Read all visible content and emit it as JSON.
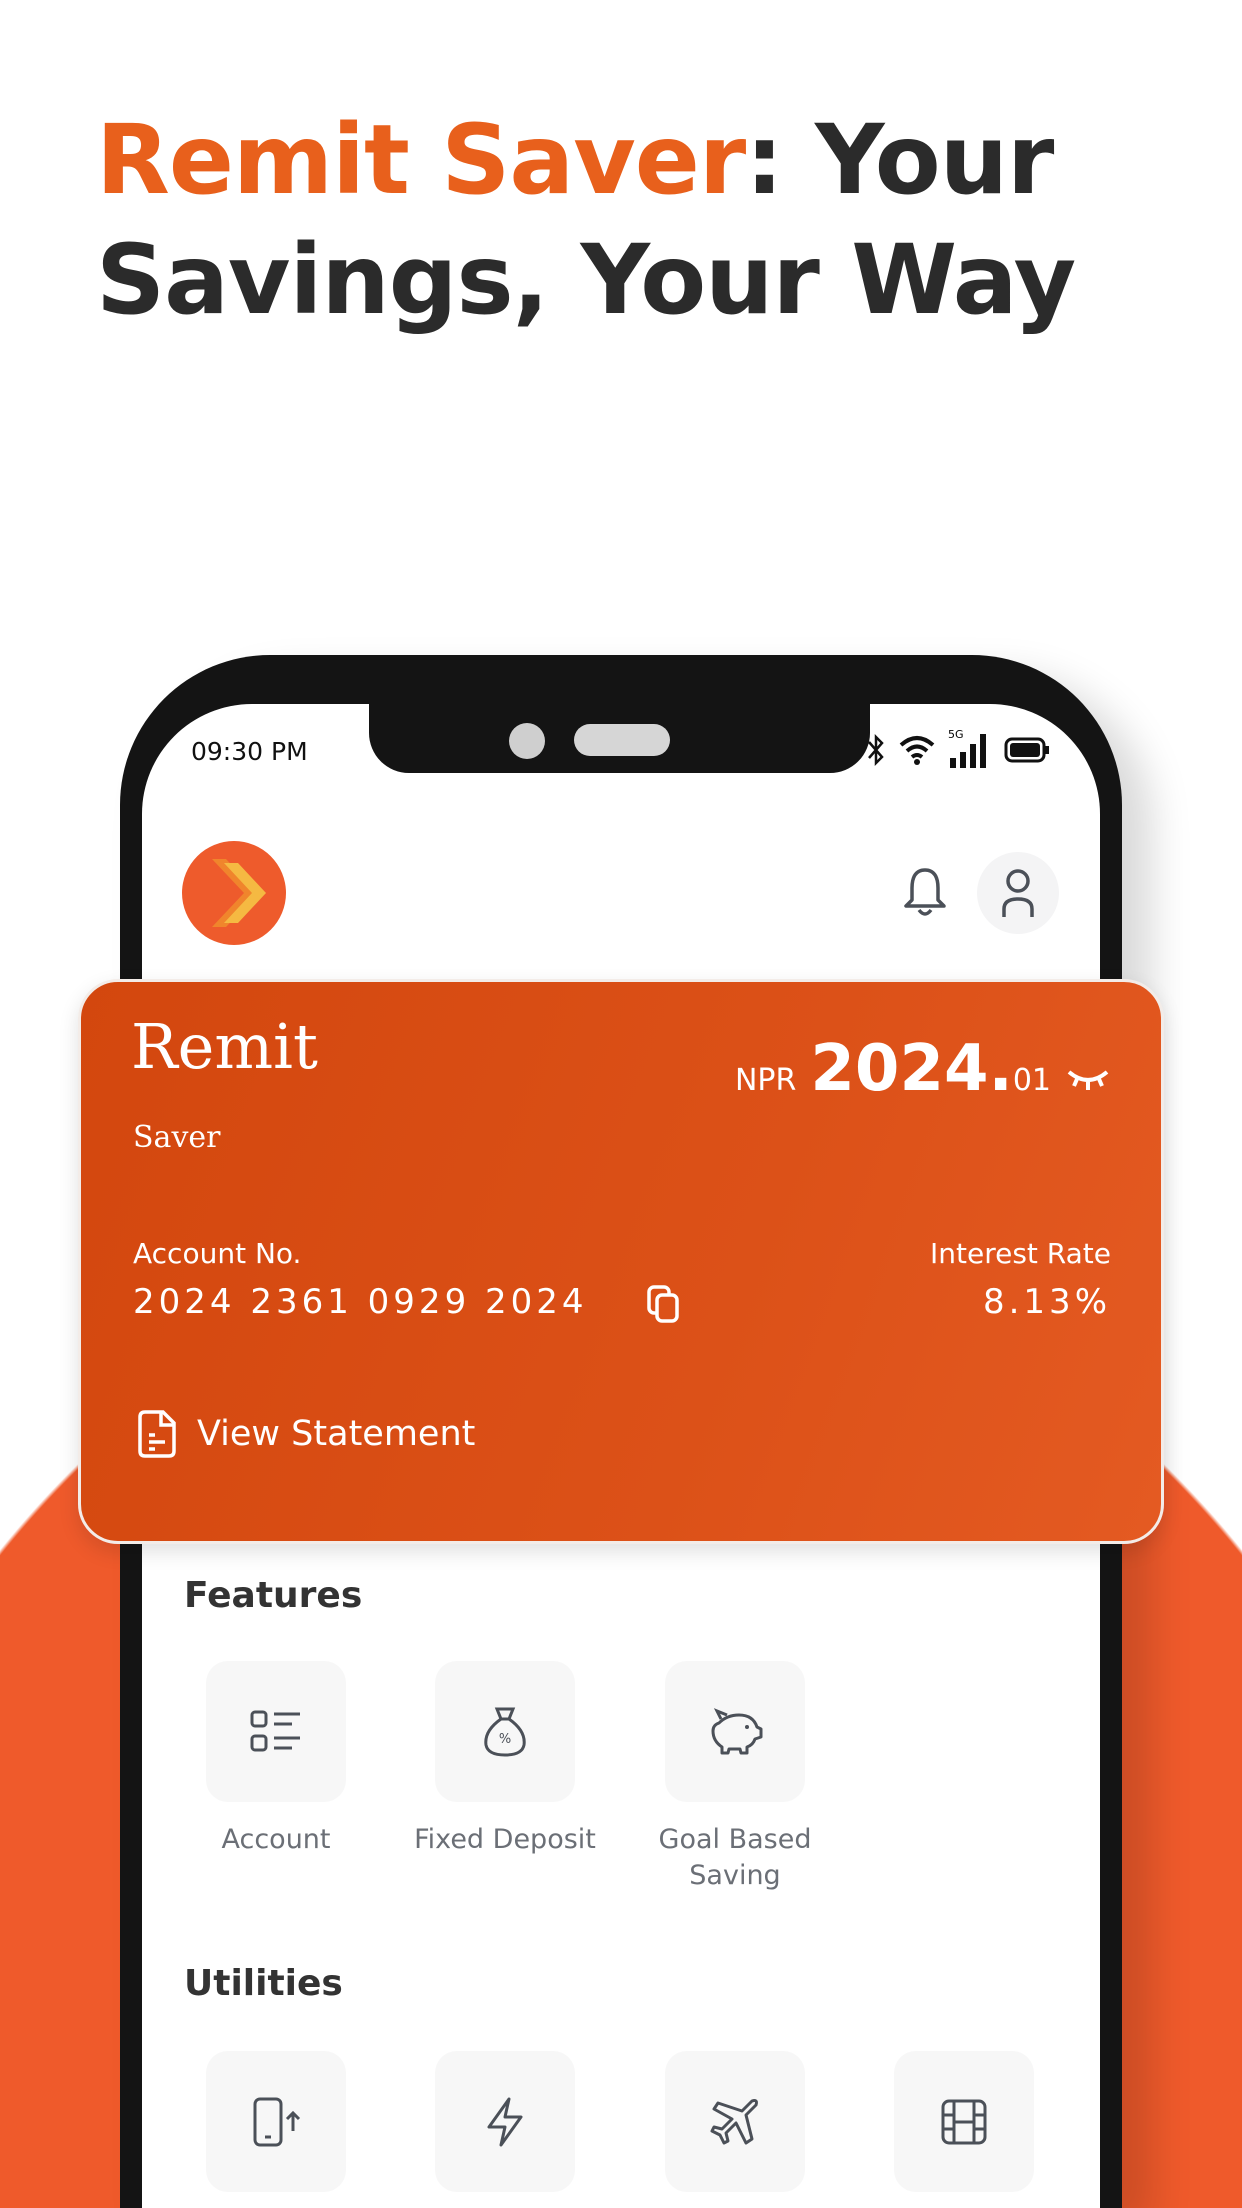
{
  "headline": {
    "accent": "Remit Saver",
    "rest_line1": ": Your",
    "line2": "Savings, Your Way"
  },
  "status_bar": {
    "time": "09:30 PM",
    "network": "5G"
  },
  "card": {
    "brand_line1": "Remit",
    "brand_line2": "Saver",
    "currency": "NPR",
    "balance_whole": "2024.",
    "balance_decimal": "01",
    "account_label": "Account No.",
    "account_number": "2024 2361 0929 2024",
    "interest_label": "Interest Rate",
    "interest_rate": "8.13%",
    "statement_label": "View Statement"
  },
  "features": {
    "title": "Features",
    "items": [
      {
        "label": "Account",
        "icon": "list-icon"
      },
      {
        "label": "Fixed Deposit",
        "icon": "money-bag-icon"
      },
      {
        "label": "Goal Based Saving",
        "icon": "piggy-bank-icon"
      }
    ]
  },
  "utilities": {
    "title": "Utilities",
    "items": [
      {
        "icon": "mobile-topup-icon"
      },
      {
        "icon": "electricity-icon"
      },
      {
        "icon": "flight-icon"
      },
      {
        "icon": "movie-icon"
      }
    ]
  },
  "colors": {
    "accent": "#e8601c",
    "card": "#d84c12",
    "background_shape": "#ef5a2b"
  }
}
